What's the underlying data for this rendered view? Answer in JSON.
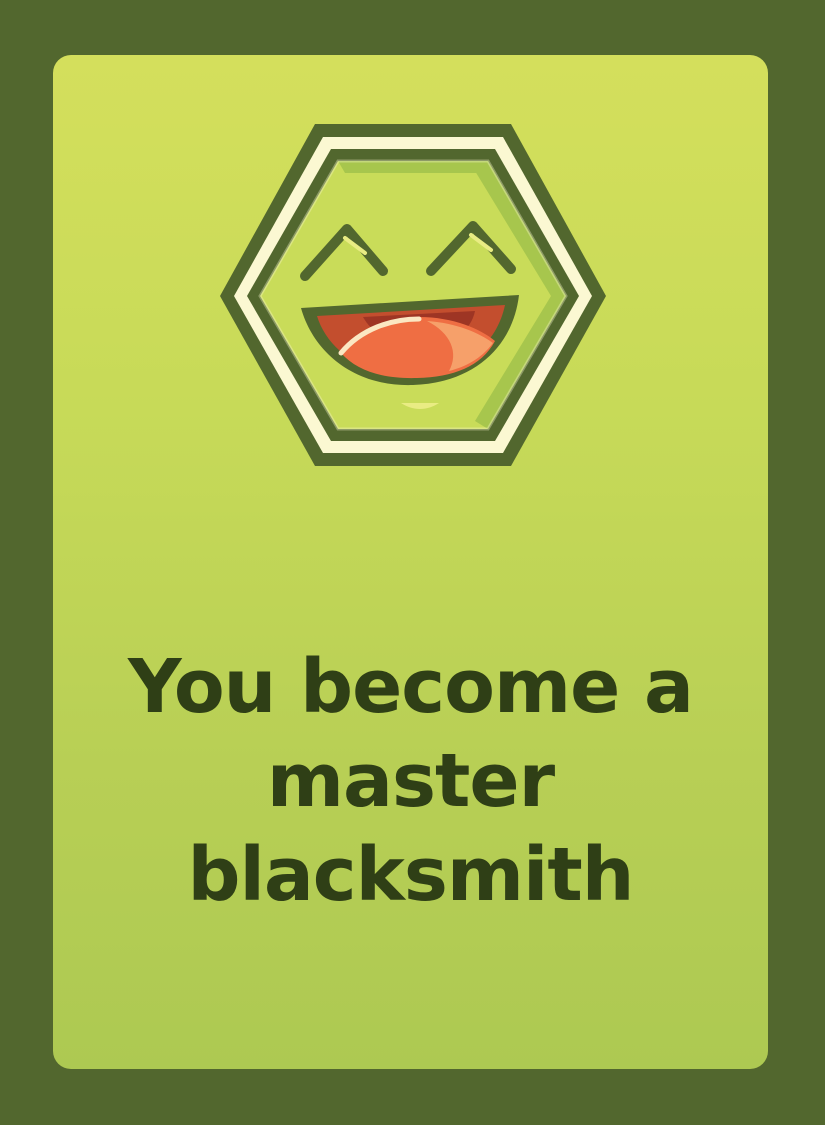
{
  "card": {
    "message": "You become a master blacksmith",
    "icon": "laughing-face-hexagon-icon"
  },
  "colors": {
    "frame": "#52672e",
    "card_top": "#d4df5c",
    "card_bottom": "#adc952",
    "text": "#2f3f16",
    "hex_outline": "#52672e",
    "hex_inner_light": "#fbf8d2",
    "face_green": "#c9dc59",
    "mouth_red": "#c34e2e",
    "tongue": "#ef6e43"
  }
}
